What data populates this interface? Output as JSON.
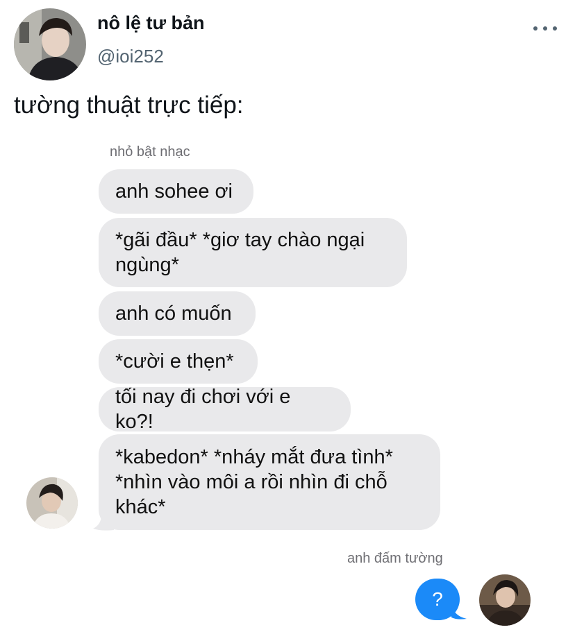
{
  "tweet": {
    "display_name": "nô lệ tư bản",
    "handle": "@ioi252",
    "text": "tường thuật trực tiếp:"
  },
  "chat": {
    "sender_name": "nhỏ bật nhạc",
    "messages": [
      "anh sohee ơi",
      "*gãi đầu* *giơ tay chào ngại ngùng*",
      "anh có muốn",
      "*cười e thẹn*",
      "tối nay đi chơi với e ko?!",
      "*kabedon* *nháy mắt đưa tình* *nhìn vào môi a rồi nhìn đi chỗ khác*"
    ],
    "reply_name": "anh đấm tường",
    "reply_text": "?"
  },
  "icons": {
    "more": "more-horizontal-icon"
  },
  "colors": {
    "incoming_bubble": "#e9e9eb",
    "outgoing_bubble": "#1b8af8",
    "handle_gray": "#536471"
  }
}
